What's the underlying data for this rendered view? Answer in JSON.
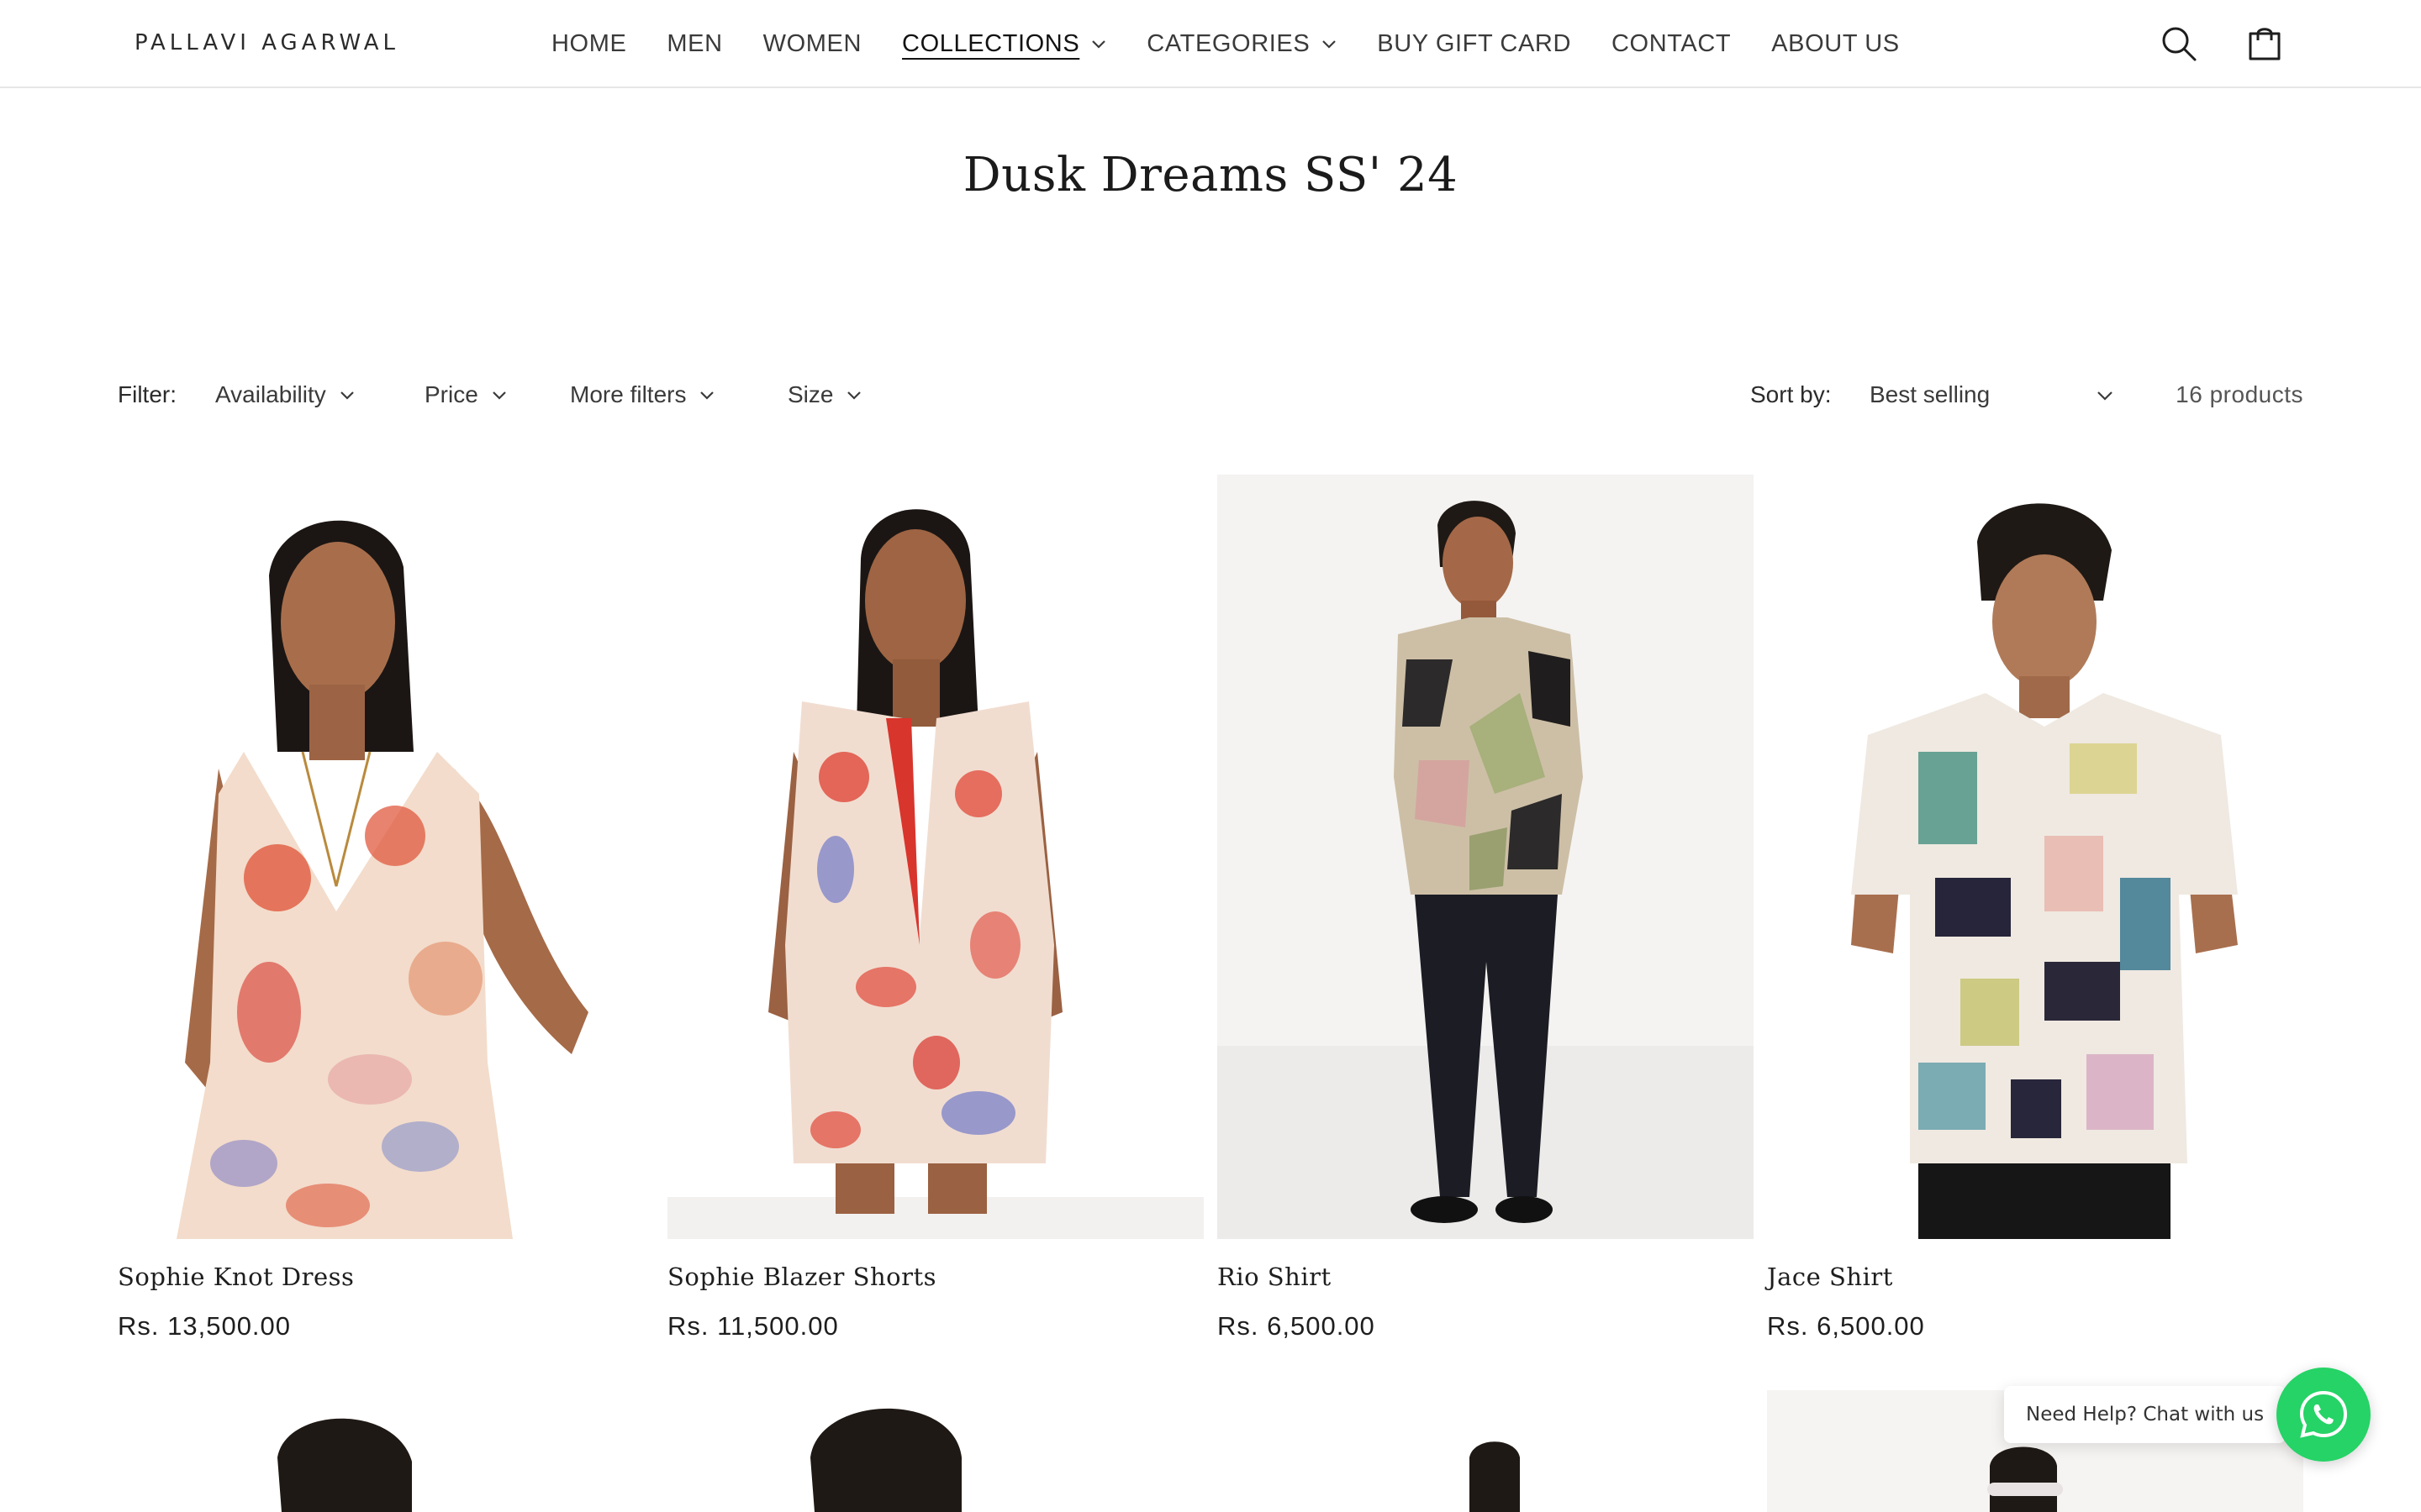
{
  "brand": {
    "logo_text": "PALLAVI AGARWAL"
  },
  "nav": {
    "items": [
      {
        "label": "HOME",
        "has_dropdown": false,
        "active": false
      },
      {
        "label": "MEN",
        "has_dropdown": false,
        "active": false
      },
      {
        "label": "WOMEN",
        "has_dropdown": false,
        "active": false
      },
      {
        "label": "COLLECTIONS",
        "has_dropdown": true,
        "active": true
      },
      {
        "label": "CATEGORIES",
        "has_dropdown": true,
        "active": false
      },
      {
        "label": "BUY GIFT CARD",
        "has_dropdown": false,
        "active": false
      },
      {
        "label": "CONTACT",
        "has_dropdown": false,
        "active": false
      },
      {
        "label": "ABOUT US",
        "has_dropdown": false,
        "active": false
      }
    ],
    "icons": [
      "search-icon",
      "cart-icon"
    ]
  },
  "collection": {
    "title": "Dusk Dreams SS' 24"
  },
  "filters": {
    "label": "Filter:",
    "options": [
      "Availability",
      "Price",
      "More filters",
      "Size"
    ],
    "sort_label": "Sort by:",
    "sort_value": "Best selling",
    "product_count": "16 products"
  },
  "products": [
    {
      "name": "Sophie Knot Dress",
      "price": "Rs. 13,500.00"
    },
    {
      "name": "Sophie Blazer Shorts",
      "price": "Rs. 11,500.00"
    },
    {
      "name": "Rio Shirt",
      "price": "Rs. 6,500.00"
    },
    {
      "name": "Jace Shirt",
      "price": "Rs. 6,500.00"
    }
  ],
  "chat": {
    "label": "Need Help? Chat with us",
    "icon": "whatsapp-icon",
    "color": "#25d366"
  },
  "colors": {
    "text": "#121212",
    "border": "#e6e6e6",
    "accent": "#25d366"
  }
}
